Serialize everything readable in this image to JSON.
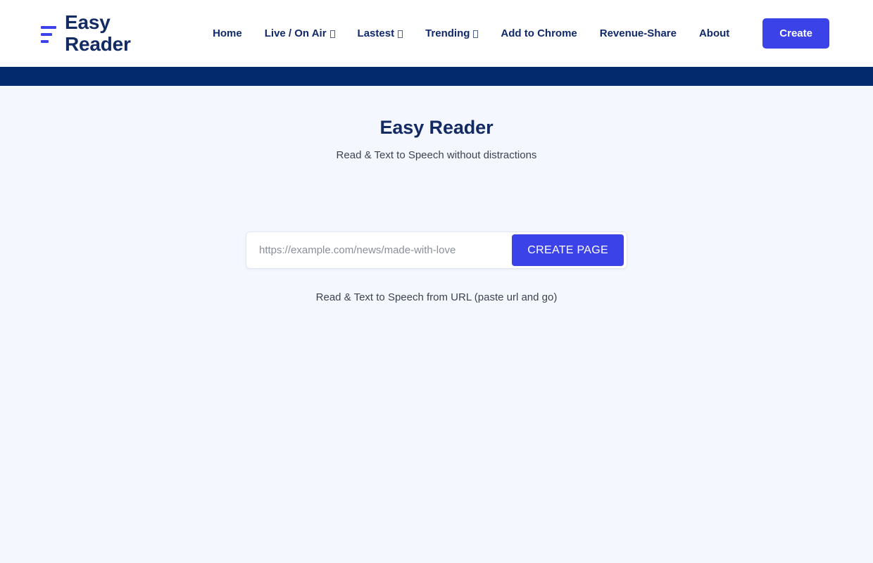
{
  "header": {
    "brand": {
      "logo_icon": "three-bars-logo-icon",
      "name": "Easy\nReader"
    },
    "nav": [
      {
        "label": "Home",
        "has_dropdown": false
      },
      {
        "label": "Live / On Air",
        "has_dropdown": true
      },
      {
        "label": "Lastest",
        "has_dropdown": true
      },
      {
        "label": "Trending",
        "has_dropdown": true
      },
      {
        "label": "Add to Chrome",
        "has_dropdown": false
      },
      {
        "label": "Revenue-Share",
        "has_dropdown": false
      },
      {
        "label": "About",
        "has_dropdown": false
      }
    ],
    "create_button": "Create"
  },
  "hero": {
    "title": "Easy Reader",
    "subtitle": "Read & Text to Speech without distractions"
  },
  "url_form": {
    "placeholder": "https://example.com/news/made-with-love",
    "value": "",
    "submit_label": "CREATE PAGE",
    "hint": "Read & Text to Speech from URL (paste url and go)"
  },
  "colors": {
    "accent": "#3b43e8",
    "navy": "#042a6e",
    "brand_text": "#132a63",
    "page_background": "#f4f7fd",
    "header_background": "#ffffff"
  }
}
